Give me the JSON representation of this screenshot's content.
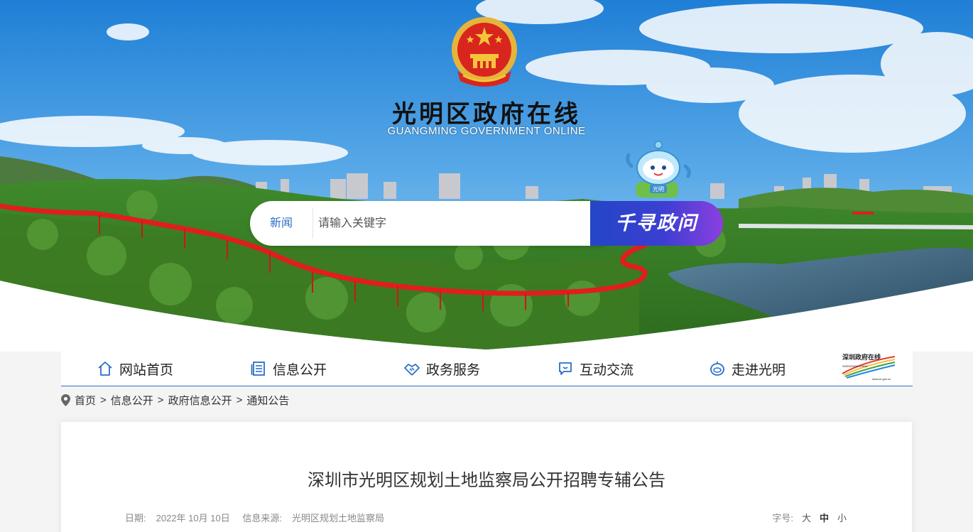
{
  "header": {
    "title": "光明区政府在线",
    "subtitle": "GUANGMING GOVERNMENT ONLINE",
    "mascot_label": "光明"
  },
  "search": {
    "category": "新闻",
    "placeholder": "请输入关键字",
    "button_label": "千寻政问"
  },
  "nav": {
    "items": [
      {
        "label": "网站首页",
        "icon": "home-icon"
      },
      {
        "label": "信息公开",
        "icon": "document-icon"
      },
      {
        "label": "政务服务",
        "icon": "handshake-icon"
      },
      {
        "label": "互动交流",
        "icon": "chat-icon"
      },
      {
        "label": "走进光明",
        "icon": "robot-icon"
      }
    ],
    "logo_text": "深圳政府在线",
    "logo_sub": "SHENZHEN CHINA",
    "logo_url": "www.sz.gov.cn"
  },
  "breadcrumb": {
    "items": [
      "首页",
      "信息公开",
      "政府信息公开",
      "通知公告"
    ],
    "separator": ">"
  },
  "article": {
    "title": "深圳市光明区规划土地监察局公开招聘专辅公告",
    "date_label": "日期:",
    "date": "2022年 10月 10日",
    "source_label": "信息来源:",
    "source": "光明区规划土地监察局",
    "fontsize_label": "字号:",
    "fontsize_options": [
      "大",
      "中",
      "小"
    ]
  },
  "colors": {
    "accent": "#2a6fc9",
    "button_gradient_start": "#2346c6",
    "button_gradient_end": "#8b3fe0",
    "bridge": "#e11d1d"
  }
}
